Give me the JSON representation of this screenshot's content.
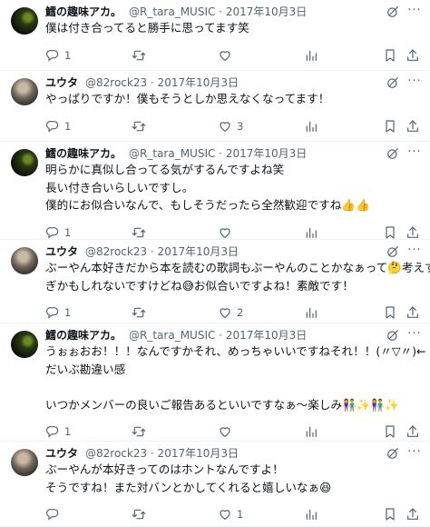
{
  "icons": {
    "reply": "reply-icon",
    "retweet": "retweet-icon",
    "like": "heart-icon",
    "views": "views-chart-icon",
    "bookmark": "bookmark-icon",
    "share": "share-icon",
    "grok": "grok-icon",
    "more": "more-icon"
  },
  "colors": {
    "text": "#0f1419",
    "muted": "#536471",
    "divider": "#eff3f4"
  },
  "tweets": [
    {
      "name": "鱈の趣味アカ。",
      "handle_date": "@R_tara_MUSIC · 2017年10月3日",
      "lines": [
        "僕は付き合ってると勝手に思ってます笑"
      ],
      "reply_count": "1",
      "retweet_count": "",
      "like_count": ""
    },
    {
      "name": "ユウタ",
      "handle_date": "@82rock23 · 2017年10月3日",
      "lines": [
        "やっぱりですか！僕もそうとしか思えなくなってます！"
      ],
      "reply_count": "1",
      "retweet_count": "",
      "like_count": "3"
    },
    {
      "name": "鱈の趣味アカ。",
      "handle_date": "@R_tara_MUSIC · 2017年10月3日",
      "lines": [
        "明らかに真似し合ってる気がするんですよね笑",
        "長い付き合いらしいですし。",
        "僕的にお似合いなんで、もしそうだったら全然歓迎ですね👍👍"
      ],
      "reply_count": "1",
      "retweet_count": "",
      "like_count": ""
    },
    {
      "name": "ユウタ",
      "handle_date": "@82rock23 · 2017年10月3日",
      "lines": [
        "ぶーやん本好きだから本を読むの歌詞もぶーやんのことかなぁって🤔考えす",
        "ぎかもしれないですけどね😅お似合いですよね！素敵です！"
      ],
      "reply_count": "1",
      "retweet_count": "",
      "like_count": "2"
    },
    {
      "name": "鱈の趣味アカ。",
      "handle_date": "@R_tara_MUSIC · 2017年10月3日",
      "lines": [
        "うぉぉおお！！！なんですかそれ、めっちゃいいですねそれ！！(〃▽〃)←",
        "だいぶ勘違い感",
        "",
        "いつかメンバーの良いご報告あるといいですなぁ〜楽しみ👫✨👫✨"
      ],
      "reply_count": "1",
      "retweet_count": "",
      "like_count": ""
    },
    {
      "name": "ユウタ",
      "handle_date": "@82rock23 · 2017年10月3日",
      "lines": [
        "ぶーやんが本好きってのはホントなんですよ！",
        "そうですね！また対バンとかしてくれると嬉しいなぁ😆"
      ],
      "reply_count": "",
      "retweet_count": "",
      "like_count": "1"
    }
  ]
}
